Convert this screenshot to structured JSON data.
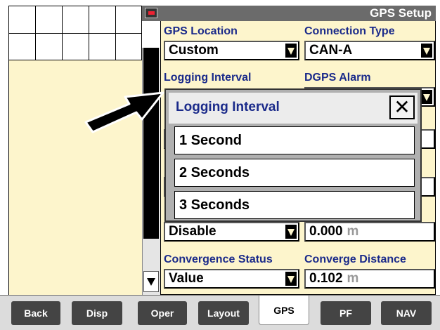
{
  "header": {
    "title": "GPS Setup",
    "icon": "gps-setup-app-icon"
  },
  "fields": {
    "gps_location": {
      "label": "GPS Location",
      "value": "Custom"
    },
    "connection_type": {
      "label": "Connection Type",
      "value": "CAN-A"
    },
    "logging_interval": {
      "label": "Logging Interval"
    },
    "dgps_alarm": {
      "label": "DGPS Alarm"
    },
    "hidden_left": {
      "value": "Disable"
    },
    "hidden_right": {
      "value": "0.000",
      "unit": "m"
    },
    "convergence_status": {
      "label": "Convergence Status",
      "value": "Value"
    },
    "converge_distance": {
      "label": "Converge Distance",
      "value": "0.102",
      "unit": "m"
    }
  },
  "popup": {
    "title": "Logging Interval",
    "close_glyph": "✕",
    "options": [
      "1 Second",
      "2 Seconds",
      "3 Seconds"
    ]
  },
  "tabs": [
    {
      "label": "Back",
      "active": false
    },
    {
      "label": "Disp",
      "active": false
    },
    {
      "label": "Oper",
      "active": false
    },
    {
      "label": "Layout",
      "active": false
    },
    {
      "label": "GPS",
      "active": true
    },
    {
      "label": "PF",
      "active": false
    },
    {
      "label": "NAV",
      "active": false
    }
  ],
  "colors": {
    "panel_background": "#fdf5cc",
    "label_text": "#1a2a8a",
    "titlebar": "#6b6b6b",
    "tab_inactive": "#444444"
  }
}
